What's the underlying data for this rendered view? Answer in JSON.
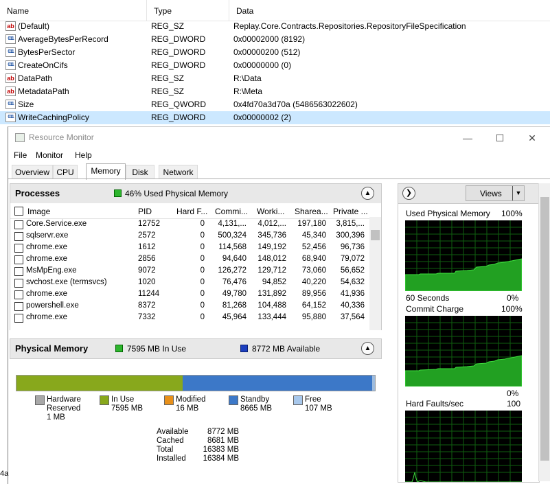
{
  "registry": {
    "columns": [
      "Name",
      "Type",
      "Data"
    ],
    "rows": [
      {
        "icon": "string-value-icon",
        "name": "(Default)",
        "type": "REG_SZ",
        "data": "Replay.Core.Contracts.Repositories.RepositoryFileSpecification"
      },
      {
        "icon": "binary-value-icon",
        "name": "AverageBytesPerRecord",
        "type": "REG_DWORD",
        "data": "0x00002000 (8192)"
      },
      {
        "icon": "binary-value-icon",
        "name": "BytesPerSector",
        "type": "REG_DWORD",
        "data": "0x00000200 (512)"
      },
      {
        "icon": "binary-value-icon",
        "name": "CreateOnCifs",
        "type": "REG_DWORD",
        "data": "0x00000000 (0)"
      },
      {
        "icon": "string-value-icon",
        "name": "DataPath",
        "type": "REG_SZ",
        "data": "R:\\Data"
      },
      {
        "icon": "string-value-icon",
        "name": "MetadataPath",
        "type": "REG_SZ",
        "data": "R:\\Meta"
      },
      {
        "icon": "binary-value-icon",
        "name": "Size",
        "type": "REG_QWORD",
        "data": "0x4fd70a3d70a (5486563022602)"
      },
      {
        "icon": "binary-value-icon",
        "name": "WriteCachingPolicy",
        "type": "REG_DWORD",
        "data": "0x00000002 (2)"
      }
    ],
    "selected_row": 7,
    "behind_text": "4a"
  },
  "window": {
    "title": "Resource Monitor",
    "menu": [
      "File",
      "Monitor",
      "Help"
    ],
    "tabs": [
      "Overview",
      "CPU",
      "Memory",
      "Disk",
      "Network"
    ],
    "active_tab": "Memory"
  },
  "processes": {
    "title": "Processes",
    "summary": "46% Used Physical Memory",
    "columns": [
      "Image",
      "PID",
      "Hard F...",
      "Commi...",
      "Worki...",
      "Sharea...",
      "Private ..."
    ],
    "rows": [
      [
        "Core.Service.exe",
        "12752",
        "0",
        "4,131,...",
        "4,012,...",
        "197,180",
        "3,815,..."
      ],
      [
        "sqlservr.exe",
        "2572",
        "0",
        "500,324",
        "345,736",
        "45,340",
        "300,396"
      ],
      [
        "chrome.exe",
        "1612",
        "0",
        "114,568",
        "149,192",
        "52,456",
        "96,736"
      ],
      [
        "chrome.exe",
        "2856",
        "0",
        "94,640",
        "148,012",
        "68,940",
        "79,072"
      ],
      [
        "MsMpEng.exe",
        "9072",
        "0",
        "126,272",
        "129,712",
        "73,060",
        "56,652"
      ],
      [
        "svchost.exe (termsvcs)",
        "1020",
        "0",
        "76,476",
        "94,852",
        "40,220",
        "54,632"
      ],
      [
        "chrome.exe",
        "11244",
        "0",
        "49,780",
        "131,892",
        "89,956",
        "41,936"
      ],
      [
        "powershell.exe",
        "8372",
        "0",
        "81,268",
        "104,488",
        "64,152",
        "40,336"
      ],
      [
        "chrome.exe",
        "7332",
        "0",
        "45,964",
        "133,444",
        "95,880",
        "37,564"
      ]
    ]
  },
  "physical_memory": {
    "title": "Physical Memory",
    "in_use_summary": "7595 MB In Use",
    "available_summary": "8772 MB Available",
    "bar": {
      "in_use_fraction": 0.4636,
      "standby_fraction": 0.5289,
      "free_fraction": 0.0065
    },
    "legend": [
      {
        "label": "Hardware",
        "label2": "Reserved",
        "value": "1 MB",
        "color": "#a8a8a8"
      },
      {
        "label": "In Use",
        "label2": "",
        "value": "7595 MB",
        "color": "#88a81c"
      },
      {
        "label": "Modified",
        "label2": "",
        "value": "16 MB",
        "color": "#e8901a"
      },
      {
        "label": "Standby",
        "label2": "",
        "value": "8665 MB",
        "color": "#3c78c8"
      },
      {
        "label": "Free",
        "label2": "",
        "value": "107 MB",
        "color": "#a8c8ec"
      }
    ],
    "stats": [
      {
        "k": "Available",
        "v": "8772 MB"
      },
      {
        "k": "Cached",
        "v": "8681 MB"
      },
      {
        "k": "Total",
        "v": "16383 MB"
      },
      {
        "k": "Installed",
        "v": "16384 MB"
      }
    ]
  },
  "graphs": {
    "views_label": "Views",
    "panels": [
      {
        "title": "Used Physical Memory",
        "max": "100%",
        "footer_left": "60 Seconds",
        "footer_right": "0%"
      },
      {
        "title": "Commit Charge",
        "max": "100%",
        "footer_left": "",
        "footer_right": "0%"
      },
      {
        "title": "Hard Faults/sec",
        "max": "100",
        "footer_left": "",
        "footer_right": ""
      }
    ]
  },
  "colors": {
    "selection": "#cce8ff",
    "graph_green": "#2db52d",
    "graph_bg": "#000000"
  }
}
